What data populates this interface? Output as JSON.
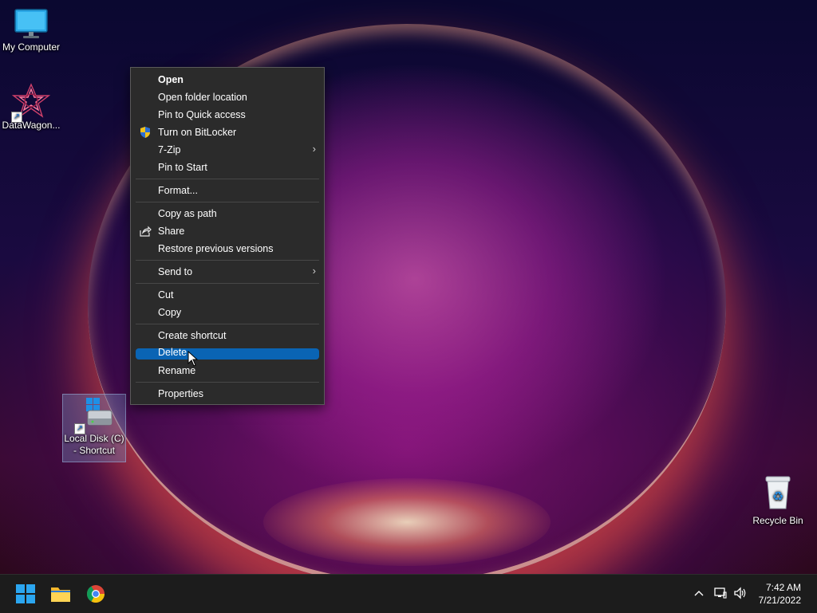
{
  "desktop": {
    "icons": [
      {
        "label": "My Computer"
      },
      {
        "label": "DataWagon..."
      },
      {
        "label": "Local Disk (C)",
        "label2": "- Shortcut"
      },
      {
        "label": "Recycle Bin"
      }
    ]
  },
  "context_menu": {
    "items": [
      {
        "label": "Open"
      },
      {
        "label": "Open folder location"
      },
      {
        "label": "Pin to Quick access"
      },
      {
        "label": "Turn on BitLocker"
      },
      {
        "label": "7-Zip"
      },
      {
        "label": "Pin to Start"
      },
      {
        "label": "Format..."
      },
      {
        "label": "Copy as path"
      },
      {
        "label": "Share"
      },
      {
        "label": "Restore previous versions"
      },
      {
        "label": "Send to"
      },
      {
        "label": "Cut"
      },
      {
        "label": "Copy"
      },
      {
        "label": "Create shortcut"
      },
      {
        "label": "Delete"
      },
      {
        "label": "Rename"
      },
      {
        "label": "Properties"
      }
    ],
    "submenu_glyph": "›",
    "highlight_color": "#0a64b4"
  },
  "taskbar": {
    "apps": [
      {
        "icon": "windows-start-icon"
      },
      {
        "icon": "file-explorer-icon"
      },
      {
        "icon": "chrome-icon"
      }
    ],
    "tray": {
      "chevron": "^",
      "icons": [
        "network-icon",
        "volume-icon"
      ]
    },
    "clock": {
      "time": "7:42 AM",
      "date": "7/21/2022"
    }
  }
}
